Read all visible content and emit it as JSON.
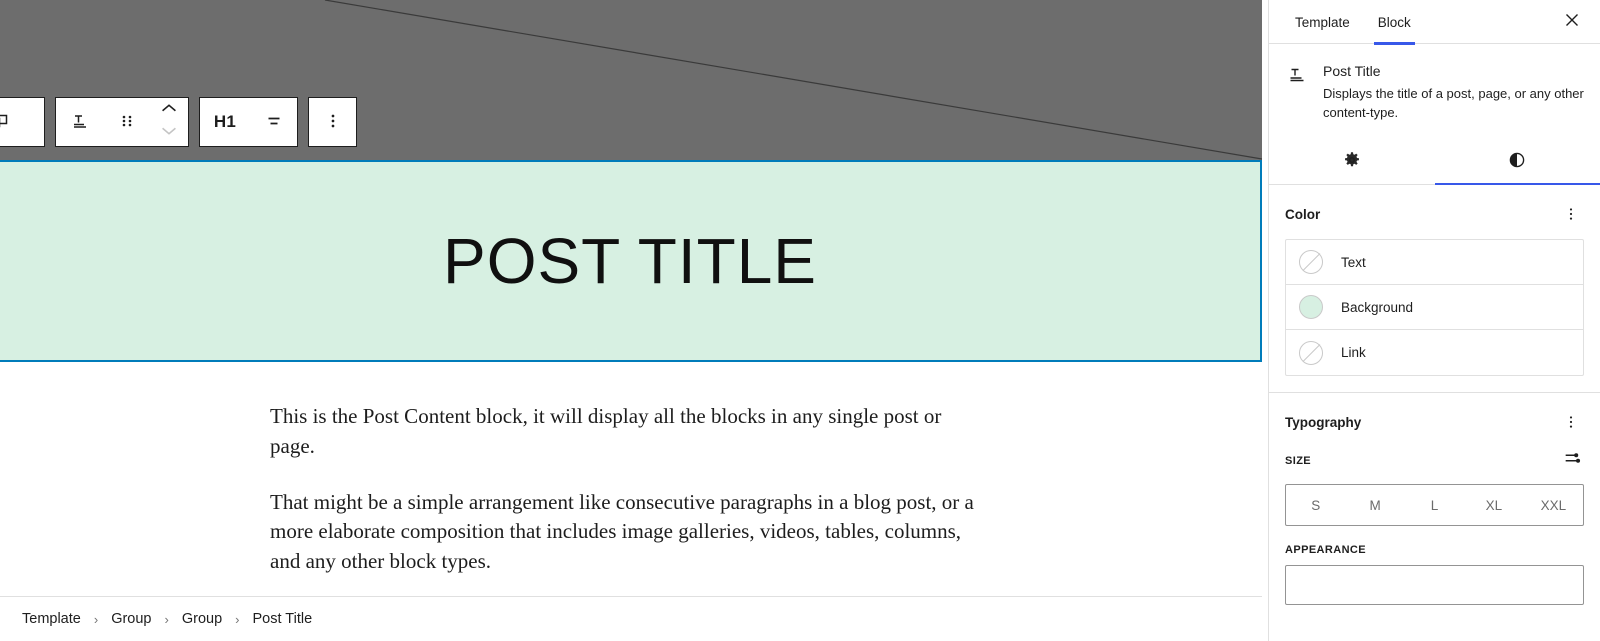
{
  "canvas": {
    "title_block": {
      "text": "POST TITLE",
      "background_color": "#d7f0e2",
      "selection_color": "#007cba"
    },
    "post_content": {
      "paragraphs": [
        "This is the Post Content block, it will display all the blocks in any single post or page.",
        "That might be a simple arrangement like consecutive paragraphs in a blog post, or a more elaborate composition that includes image galleries, videos, tables, columns, and any other block types."
      ]
    }
  },
  "toolbar": {
    "select_parent_label": "Select parent block",
    "block_type_label": "Post Title",
    "drag_label": "Drag",
    "move_up_label": "Move up",
    "move_down_label": "Move down",
    "heading_level_label": "H1",
    "align_label": "Align text",
    "options_label": "Options"
  },
  "breadcrumb": {
    "items": [
      "Template",
      "Group",
      "Group",
      "Post Title"
    ],
    "separator": "›"
  },
  "sidebar": {
    "tabs": [
      {
        "label": "Template",
        "active": false
      },
      {
        "label": "Block",
        "active": true
      }
    ],
    "close_label": "Close settings",
    "block_card": {
      "name": "Post Title",
      "description": "Displays the title of a post, page, or any other content-type.",
      "icon": "post-title-icon"
    },
    "icon_tabs": [
      {
        "name": "settings-tab",
        "icon": "gear-icon",
        "active": false
      },
      {
        "name": "styles-tab",
        "icon": "contrast-icon",
        "active": true
      }
    ],
    "color": {
      "title": "Color",
      "options_label": "Color options",
      "rows": [
        {
          "label": "Text",
          "value": null,
          "swatch": "#ffffff"
        },
        {
          "label": "Background",
          "value": "#d7f0e2",
          "swatch": "#d7f0e2"
        },
        {
          "label": "Link",
          "value": null,
          "swatch": "#ffffff"
        }
      ]
    },
    "typography": {
      "title": "Typography",
      "options_label": "Typography options",
      "size_label": "SIZE",
      "size_settings_label": "Set custom size",
      "sizes": [
        "S",
        "M",
        "L",
        "XL",
        "XXL"
      ],
      "appearance_label": "APPEARANCE"
    },
    "accent_color": "#3858e9"
  }
}
